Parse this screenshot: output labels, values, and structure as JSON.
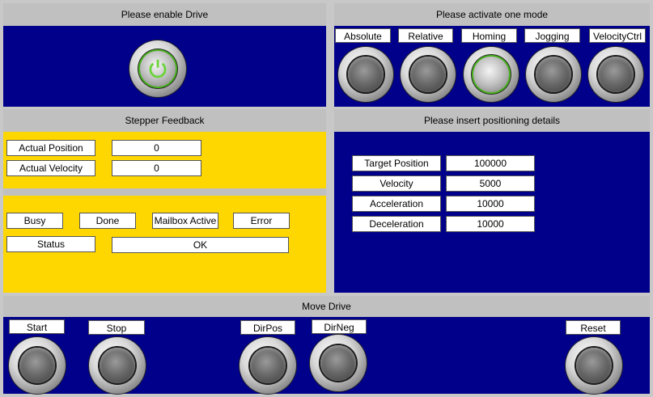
{
  "enable_panel": {
    "header": "Please enable Drive",
    "power_icon": "power-icon"
  },
  "mode_panel": {
    "header": "Please activate one mode",
    "modes": [
      "Absolute",
      "Relative",
      "Homing",
      "Jogging",
      "VelocityCtrl"
    ],
    "active_mode": "Homing"
  },
  "feedback_panel": {
    "header": "Stepper Feedback",
    "actual_position_label": "Actual Position",
    "actual_position_value": "0",
    "actual_velocity_label": "Actual Velocity",
    "actual_velocity_value": "0"
  },
  "status_panel": {
    "flags": [
      "Busy",
      "Done",
      "Mailbox Active",
      "Error"
    ],
    "status_label": "Status",
    "status_value": "OK"
  },
  "positioning_panel": {
    "header": "Please insert positioning details",
    "fields": [
      {
        "label": "Target Position",
        "value": "100000"
      },
      {
        "label": "Velocity",
        "value": "5000"
      },
      {
        "label": "Acceleration",
        "value": "10000"
      },
      {
        "label": "Deceleration",
        "value": "10000"
      }
    ]
  },
  "move_panel": {
    "header": "Move Drive",
    "buttons": [
      "Start",
      "Stop",
      "DirPos",
      "DirNeg",
      "Reset"
    ]
  },
  "colors": {
    "panel_blue": "#00008b",
    "panel_yellow": "#ffd700",
    "header_gray": "#c0c0c0",
    "active_ring": "#49b31e"
  }
}
